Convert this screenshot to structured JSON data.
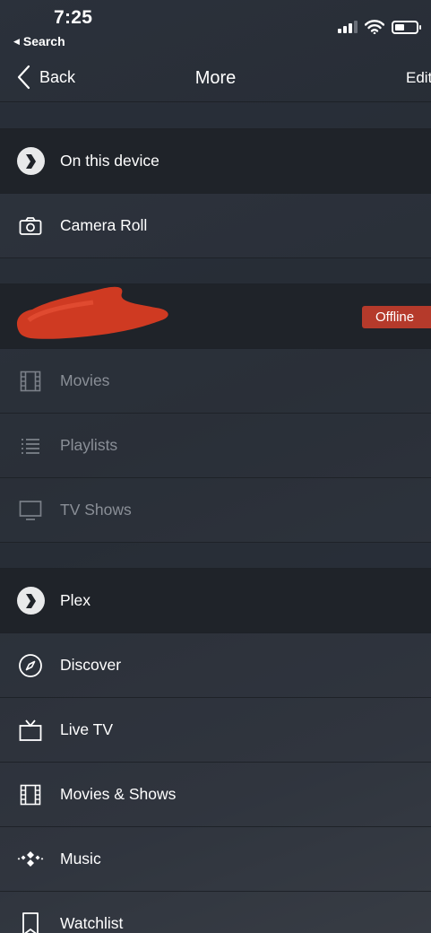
{
  "status_bar": {
    "time": "7:25",
    "back_app_label": "Search"
  },
  "nav": {
    "back_label": "Back",
    "title": "More",
    "edit_label": "Edit"
  },
  "sections": {
    "device": {
      "header_label": "On this device",
      "items": [
        {
          "label": "Camera Roll",
          "icon": "camera-icon"
        }
      ]
    },
    "server": {
      "status_badge": "Offline",
      "items": [
        {
          "label": "Movies",
          "icon": "film-icon"
        },
        {
          "label": "Playlists",
          "icon": "list-icon"
        },
        {
          "label": "TV Shows",
          "icon": "monitor-icon"
        }
      ]
    },
    "plex": {
      "header_label": "Plex",
      "items": [
        {
          "label": "Discover",
          "icon": "compass-icon"
        },
        {
          "label": "Live TV",
          "icon": "tv-icon"
        },
        {
          "label": "Movies & Shows",
          "icon": "film-icon"
        },
        {
          "label": "Music",
          "icon": "music-dots-icon"
        },
        {
          "label": "Watchlist",
          "icon": "bookmark-icon"
        }
      ]
    }
  },
  "colors": {
    "offline_badge": "#b53a2b",
    "header_row": "#1f2329",
    "background": "#2b313b"
  }
}
